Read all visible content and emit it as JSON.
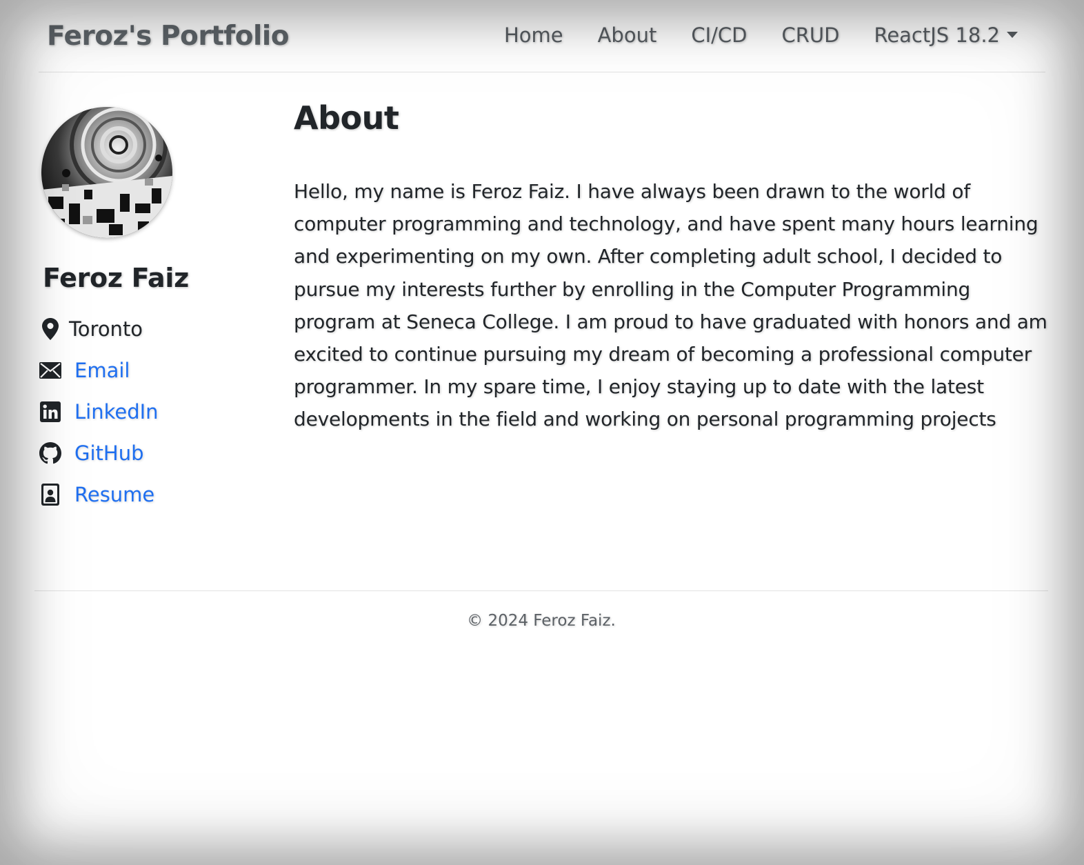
{
  "navbar": {
    "brand": "Feroz's Portfolio",
    "links": [
      "Home",
      "About",
      "CI/CD",
      "CRUD"
    ],
    "dropdown_label": "ReactJS 18.2"
  },
  "profile": {
    "name": "Feroz Faiz",
    "location": "Toronto",
    "links": [
      {
        "label": "Email",
        "icon": "envelope-icon"
      },
      {
        "label": "LinkedIn",
        "icon": "linkedin-icon"
      },
      {
        "label": "GitHub",
        "icon": "github-icon"
      },
      {
        "label": "Resume",
        "icon": "resume-icon"
      }
    ],
    "location_icon": "map-pin-icon"
  },
  "about": {
    "title": "About",
    "paragraph": "Hello, my name is Feroz Faiz. I have always been drawn to the world of computer programming and technology, and have spent many hours learning and experimenting on my own. After completing adult school, I decided to pursue my interests further by enrolling in the Computer Programming program at Seneca College. I am proud to have graduated with honors and am excited to continue pursuing my dream of becoming a professional computer programmer. In my spare time, I enjoy staying up to date with the latest developments in the field and working on personal programming projects"
  },
  "footer": {
    "text": "© 2024 Feroz Faiz."
  },
  "colors": {
    "link": "#1f6ff0",
    "text": "#212529",
    "nav_text": "#575c61"
  }
}
